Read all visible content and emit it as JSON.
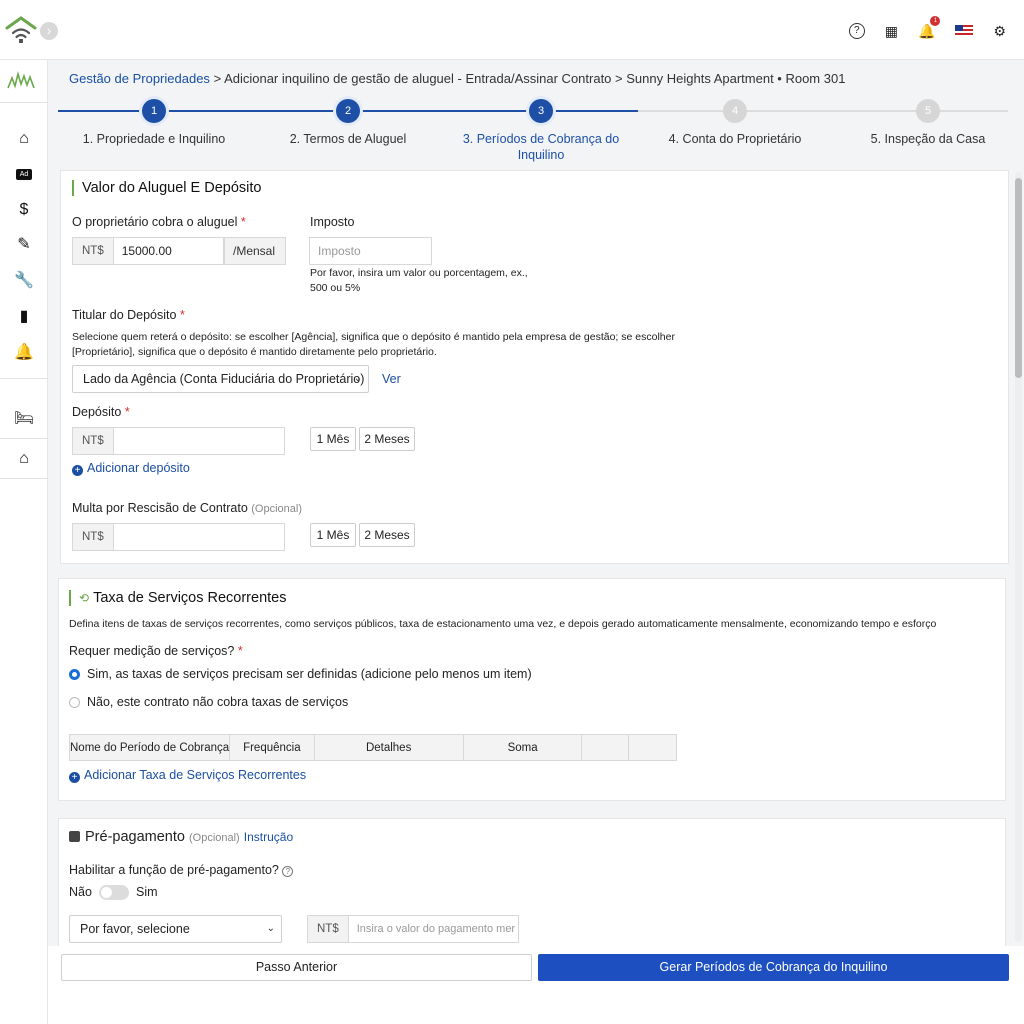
{
  "breadcrumb": {
    "root": "Gestão de Propriedades",
    "separator": ">",
    "page": "Adicionar inquilino de gestão de aluguel - Entrada/Assinar Contrato",
    "property": "Sunny Heights Apartment • Room 301"
  },
  "steps": [
    {
      "num": "1",
      "label": "1. Propriedade e Inquilino"
    },
    {
      "num": "2",
      "label": "2. Termos de Aluguel"
    },
    {
      "num": "3",
      "label": "3. Períodos de Cobrança do Inquilino"
    },
    {
      "num": "4",
      "label": "4. Conta do Proprietário"
    },
    {
      "num": "5",
      "label": "5. Inspeção da Casa"
    }
  ],
  "header_icons": {
    "bell_badge": "1"
  },
  "rent": {
    "title": "Valor do Aluguel E Depósito",
    "rent_label": "O proprietário cobra o aluguel",
    "required_mark": "*",
    "currency": "NT$",
    "rent_value": "15000.00",
    "rent_suffix": "/Mensal",
    "tax_label": "Imposto",
    "tax_placeholder": "Imposto",
    "tax_hint": "Por favor, insira um valor ou porcentagem, ex., 500 ou 5%",
    "holder_label": "Titular do Depósito",
    "holder_hint": "Selecione quem reterá o depósito: se escolher [Agência], significa que o depósito é mantido pela empresa de gestão; se escolher [Proprietário], significa que o depósito é mantido diretamente pelo proprietário.",
    "holder_selected": "Lado da Agência (Conta Fiduciária do Proprietário)",
    "holder_view_link": "Ver",
    "deposit_label": "Depósito",
    "one_month": "1 Mês",
    "two_months": "2 Meses",
    "add_deposit": "Adicionar depósito",
    "penalty_label": "Multa por Rescisão de Contrato",
    "penalty_optional": "(Opcional)"
  },
  "recurring": {
    "title": "Taxa de Serviços Recorrentes",
    "description": "Defina itens de taxas de serviços recorrentes, como serviços públicos, taxa de estacionamento uma vez, e depois gerado automaticamente mensalmente, economizando tempo e esforço",
    "metering_label": "Requer medição de serviços?",
    "required_mark": "*",
    "option_yes": "Sim, as taxas de serviços precisam ser definidas (adicione pelo menos um item)",
    "option_no": "Não, este contrato não cobra taxas de serviços",
    "selected": "yes",
    "columns": [
      "Nome do Período de Cobrança",
      "Frequência",
      "Detalhes",
      "Soma",
      "",
      ""
    ],
    "add_link": "Adicionar Taxa de Serviços Recorrentes"
  },
  "prepayment": {
    "title": "Pré-pagamento",
    "optional": "(Opcional)",
    "instruction_link": "Instrução",
    "enable_label": "Habilitar a função de pré-pagamento?",
    "toggle_off": "Não",
    "toggle_on": "Sim",
    "toggle_value": "off",
    "select_placeholder": "Por favor, selecione",
    "currency": "NT$",
    "amount_placeholder": "Insira o valor do pagamento mer"
  },
  "footer": {
    "prev": "Passo Anterior",
    "next": "Gerar Períodos de Cobrança do Inquilino"
  },
  "colors": {
    "primary": "#1d4fa7",
    "accent_green": "#6aa64a",
    "required": "#d32f2f"
  }
}
